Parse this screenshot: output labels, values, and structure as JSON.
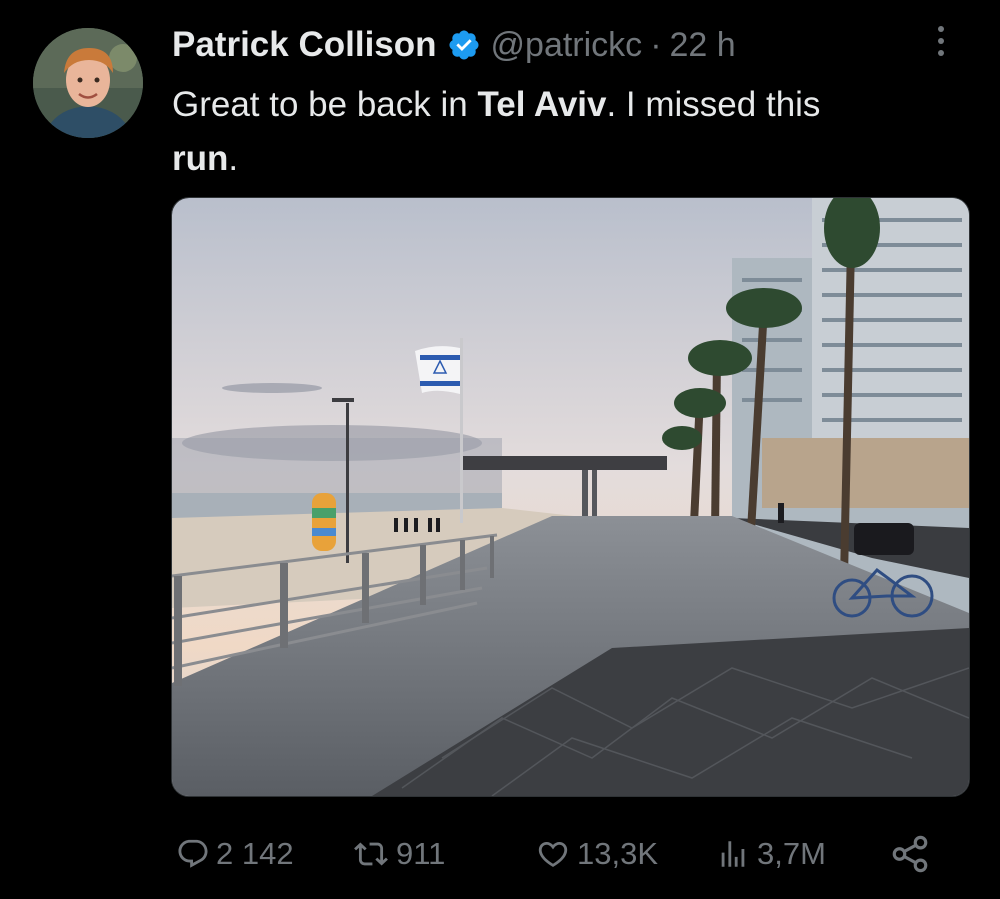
{
  "tweet": {
    "author_name": "Patrick Collison",
    "handle": "@patrickc",
    "separator": "·",
    "time": "22 h",
    "text_parts": [
      "Great to be back in ",
      "Tel Aviv",
      ". I missed this ",
      "run",
      "."
    ],
    "media_alt": "Tel Aviv beach promenade at dawn with Israeli flag, palm trees and high-rise hotel"
  },
  "actions": {
    "replies": "2 142",
    "reposts": "911",
    "likes": "13,3K",
    "views": "3,7M"
  },
  "colors": {
    "background": "#000000",
    "text": "#e7e9ea",
    "secondary": "#71767b",
    "verified": "#1d9bf0"
  },
  "icons": [
    "avatar",
    "verified-badge-icon",
    "more-options-icon",
    "reply-icon",
    "repost-icon",
    "like-icon",
    "views-icon",
    "share-icon"
  ]
}
